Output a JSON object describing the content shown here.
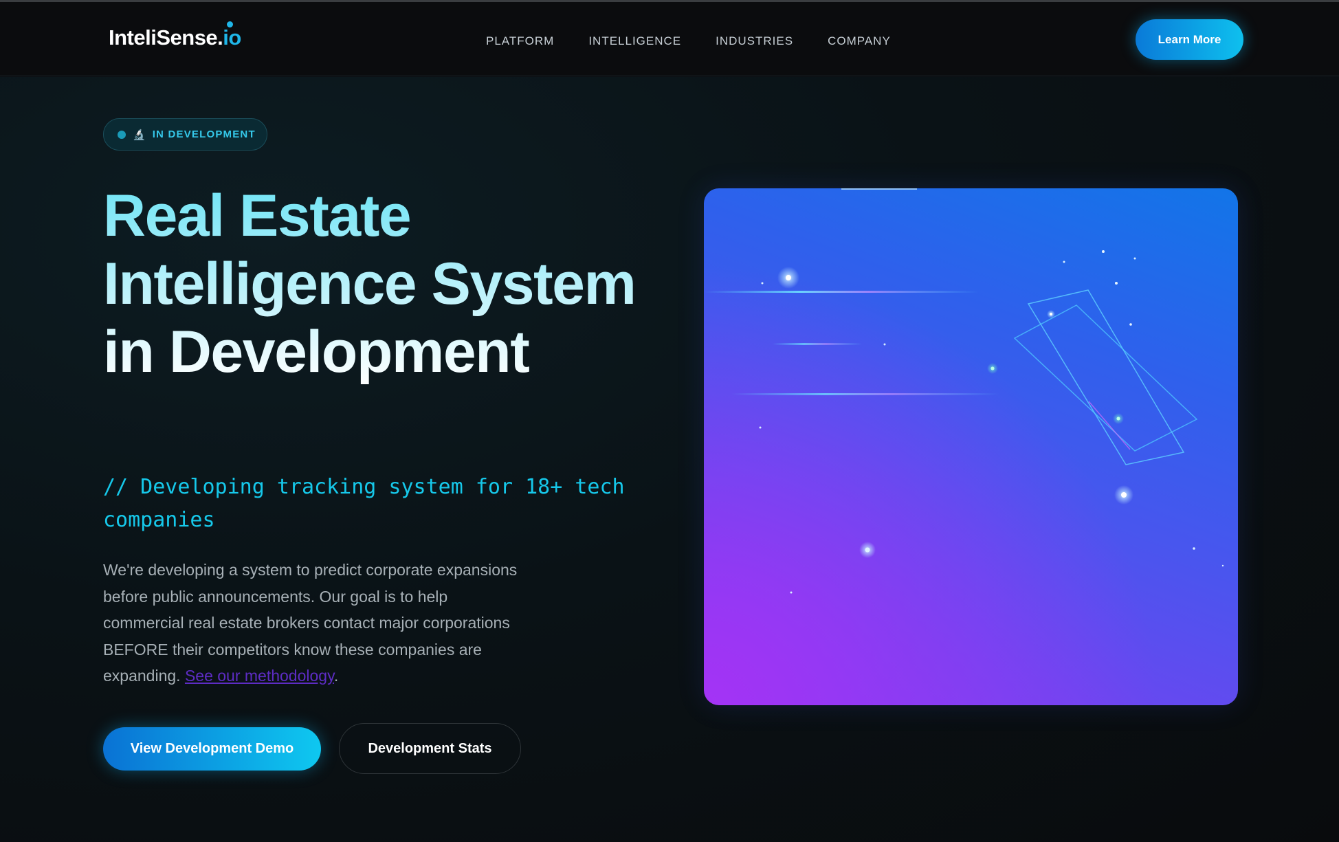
{
  "nav": {
    "logo_main": "InteliSense.",
    "logo_io": "io",
    "links": [
      "PLATFORM",
      "INTELLIGENCE",
      "INDUSTRIES",
      "COMPANY"
    ],
    "cta": "Learn More"
  },
  "hero": {
    "badge": "IN DEVELOPMENT",
    "badge_icon": "microscope-icon",
    "title": "Real Estate Intelligence System in Development",
    "subtitle": "// Developing tracking system for 18+ tech companies",
    "body": "We're developing a system to predict corporate expansions before public announcements. Our goal is to help commercial real estate brokers contact major corporations BEFORE their competitors know these companies are expanding.",
    "link_text": "See our methodology",
    "link_suffix": ".",
    "primary_button": "View Development Demo",
    "secondary_button": "Development Stats"
  },
  "colors": {
    "accent": "#0ec0ee",
    "link": "#5d2cc4",
    "visual_blue": "#1275e8",
    "visual_purple": "#a433f5"
  }
}
